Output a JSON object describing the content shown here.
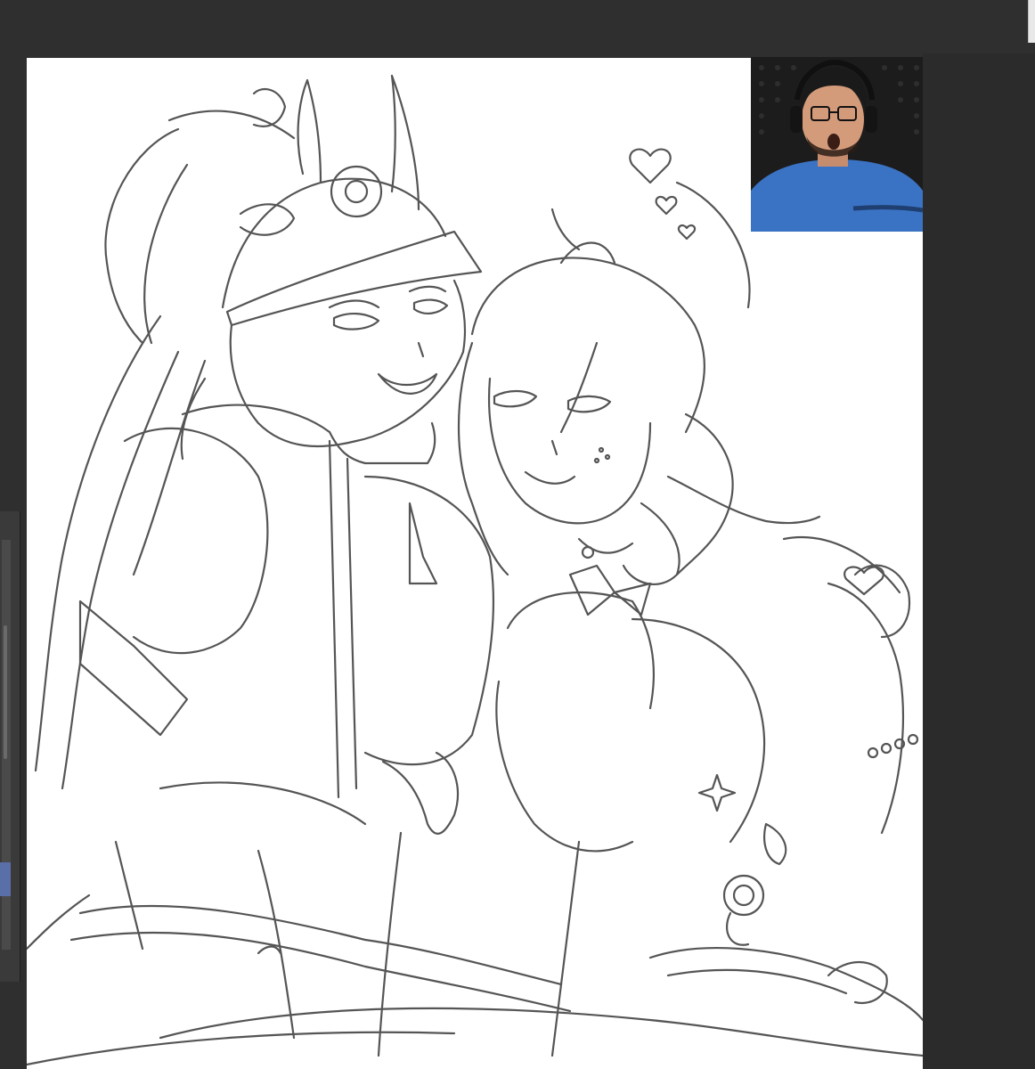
{
  "app": {
    "name": "drawing-app",
    "canvas_background": "#ffffff",
    "ui_background": "#2f2f2f",
    "selection_color": "#5a6fa8"
  },
  "webcam": {
    "shirt_color": "#3b73c4",
    "background_color": "#1c1c1c"
  },
  "icons": [
    "heart-icon",
    "sparkle-icon"
  ]
}
